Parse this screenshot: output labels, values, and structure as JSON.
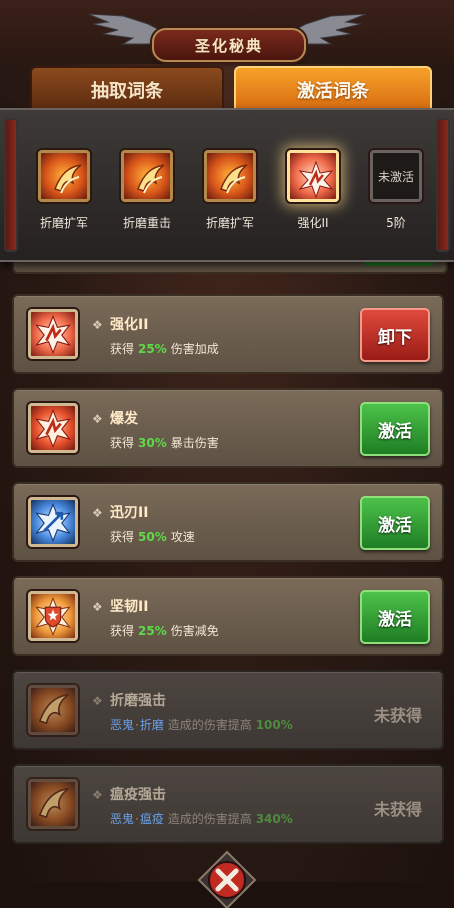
{
  "header": {
    "title": "圣化秘典"
  },
  "tabs": [
    {
      "label": "抽取词条",
      "active": false
    },
    {
      "label": "激活词条",
      "active": true
    }
  ],
  "slots": [
    {
      "label": "折磨扩军",
      "icon": "fire-claw-icon",
      "state": "filled"
    },
    {
      "label": "折磨重击",
      "icon": "fire-claw-icon",
      "state": "filled"
    },
    {
      "label": "折磨扩军",
      "icon": "fire-claw-icon",
      "state": "filled"
    },
    {
      "label": "强化II",
      "icon": "strengthen-icon",
      "state": "selected"
    },
    {
      "label": "5阶",
      "inner": "未激活",
      "state": "empty"
    }
  ],
  "entries": [
    {
      "name": "强化II",
      "prefix": "获得",
      "percent": "25%",
      "effect": "伤害加成",
      "button": "卸下",
      "button_color": "red",
      "icon": "strengthen-icon"
    },
    {
      "name": "爆发",
      "prefix": "获得",
      "percent": "30%",
      "effect": "暴击伤害",
      "button": "激活",
      "button_color": "green",
      "icon": "burst-icon"
    },
    {
      "name": "迅刃II",
      "prefix": "获得",
      "percent": "50%",
      "effect": "攻速",
      "button": "激活",
      "button_color": "green",
      "icon": "swift-blade-icon"
    },
    {
      "name": "坚韧II",
      "prefix": "获得",
      "percent": "25%",
      "effect": "伤害减免",
      "button": "激活",
      "button_color": "green",
      "icon": "shield-star-icon"
    },
    {
      "name": "折磨强击",
      "tag1": "恶鬼",
      "tag2": "折磨",
      "effect": "造成的伤害提高",
      "percent": "100%",
      "status": "未获得",
      "icon": "fire-claw-icon"
    },
    {
      "name": "瘟疫强击",
      "tag1": "恶鬼",
      "tag2": "瘟疫",
      "effect": "造成的伤害提高",
      "percent": "340%",
      "status": "未获得",
      "icon": "fire-claw-icon"
    }
  ],
  "colors": {
    "accent_orange": "#f6a12a",
    "green_button": "#2f9a32",
    "red_button": "#c22a20",
    "percent_green": "#5fd84a",
    "tag_blue": "#6aa0e8"
  }
}
